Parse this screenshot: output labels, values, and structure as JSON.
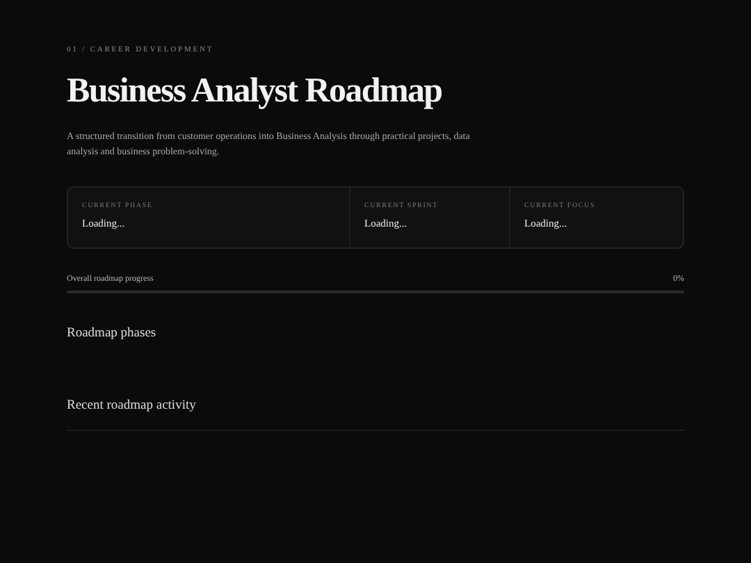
{
  "eyebrow": "01 / CAREER DEVELOPMENT",
  "title": "Business Analyst Roadmap",
  "description": "A structured transition from customer operations into Business Analysis through practical projects, data analysis and business problem-solving.",
  "stats": [
    {
      "label": "CURRENT PHASE",
      "value": "Loading..."
    },
    {
      "label": "CURRENT SPRINT",
      "value": "Loading..."
    },
    {
      "label": "CURRENT FOCUS",
      "value": "Loading..."
    }
  ],
  "progress": {
    "label": "Overall roadmap progress",
    "reading": "0%",
    "level": 0
  },
  "sections": [
    {
      "heading": "Roadmap phases"
    },
    {
      "heading": "Recent roadmap activity",
      "divider": true
    }
  ]
}
